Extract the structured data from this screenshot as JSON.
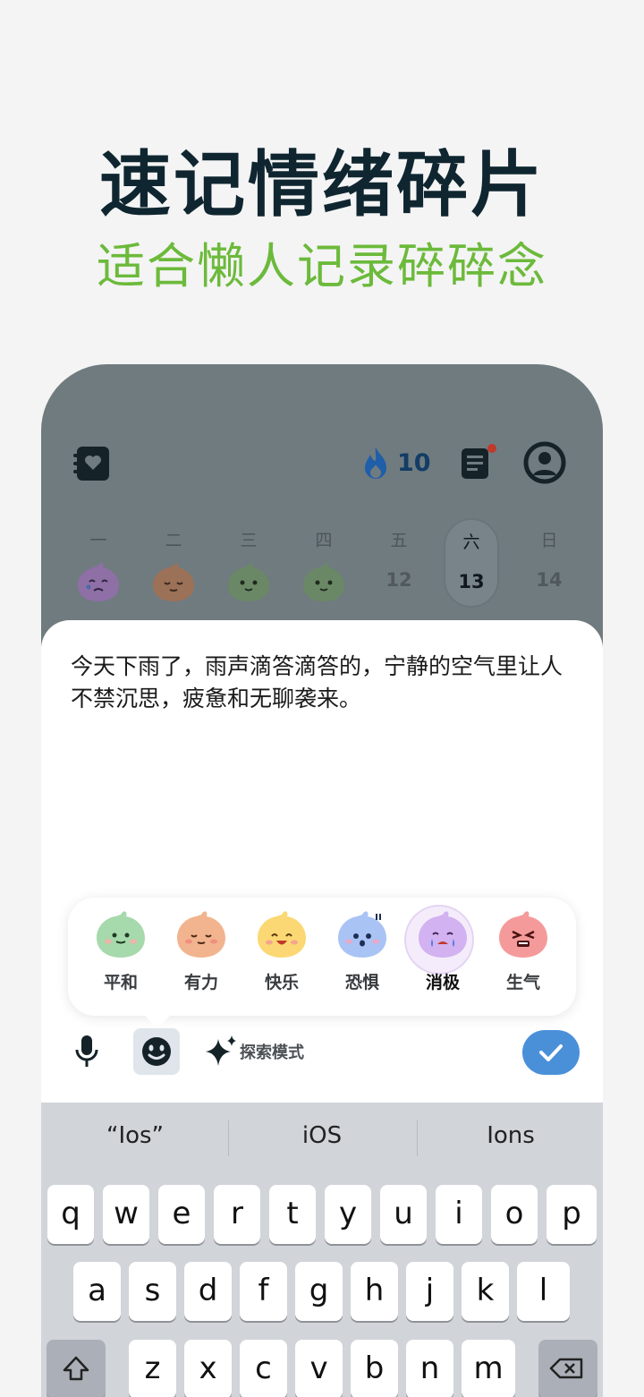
{
  "headline": "速记情绪碎片",
  "subline": "适合懒人记录碎碎念",
  "topbar": {
    "journal_icon": "journal-heart-icon",
    "streak_icon": "flame-icon",
    "streak_count": "10",
    "list_icon": "scroll-list-icon",
    "profile_icon": "user-profile-icon"
  },
  "week": [
    {
      "label": "一",
      "mood": "cry"
    },
    {
      "label": "二",
      "mood": "calm-orange"
    },
    {
      "label": "三",
      "mood": "smile-green"
    },
    {
      "label": "四",
      "mood": "smile-green"
    },
    {
      "label": "五",
      "num": "12"
    },
    {
      "label": "六",
      "num": "13",
      "selected": true
    },
    {
      "label": "日",
      "num": "14"
    }
  ],
  "note": {
    "text": "今天下雨了，雨声滴答滴答的，宁静的空气里让人不禁沉思，疲惫和无聊袭来。"
  },
  "moods": [
    {
      "label": "平和",
      "color": "#a6d9ab"
    },
    {
      "label": "有力",
      "color": "#f2b48e"
    },
    {
      "label": "快乐",
      "color": "#fbd873"
    },
    {
      "label": "恐惧",
      "color": "#a9c3f5"
    },
    {
      "label": "消极",
      "color": "#d2b2f0",
      "selected": true
    },
    {
      "label": "生气",
      "color": "#f59a9a"
    }
  ],
  "toolbar": {
    "mic_icon": "microphone-icon",
    "emoji_icon": "emoji-face-icon",
    "explore_icon": "sparkle-icon",
    "explore_label": "探索模式",
    "confirm_icon": "checkmark-icon"
  },
  "keyboard": {
    "suggestions": [
      "“Ios”",
      "iOS",
      "Ions"
    ],
    "row1": [
      "q",
      "w",
      "e",
      "r",
      "t",
      "y",
      "u",
      "i",
      "o",
      "p"
    ],
    "row2": [
      "a",
      "s",
      "d",
      "f",
      "g",
      "h",
      "j",
      "k",
      "l"
    ],
    "row3": [
      "z",
      "x",
      "c",
      "v",
      "b",
      "n",
      "m"
    ],
    "shift_icon": "shift-icon",
    "delete_icon": "backspace-icon"
  },
  "colors": {
    "accent_green": "#6cba3b",
    "headline": "#0f2630",
    "confirm_blue": "#4a90d9"
  }
}
